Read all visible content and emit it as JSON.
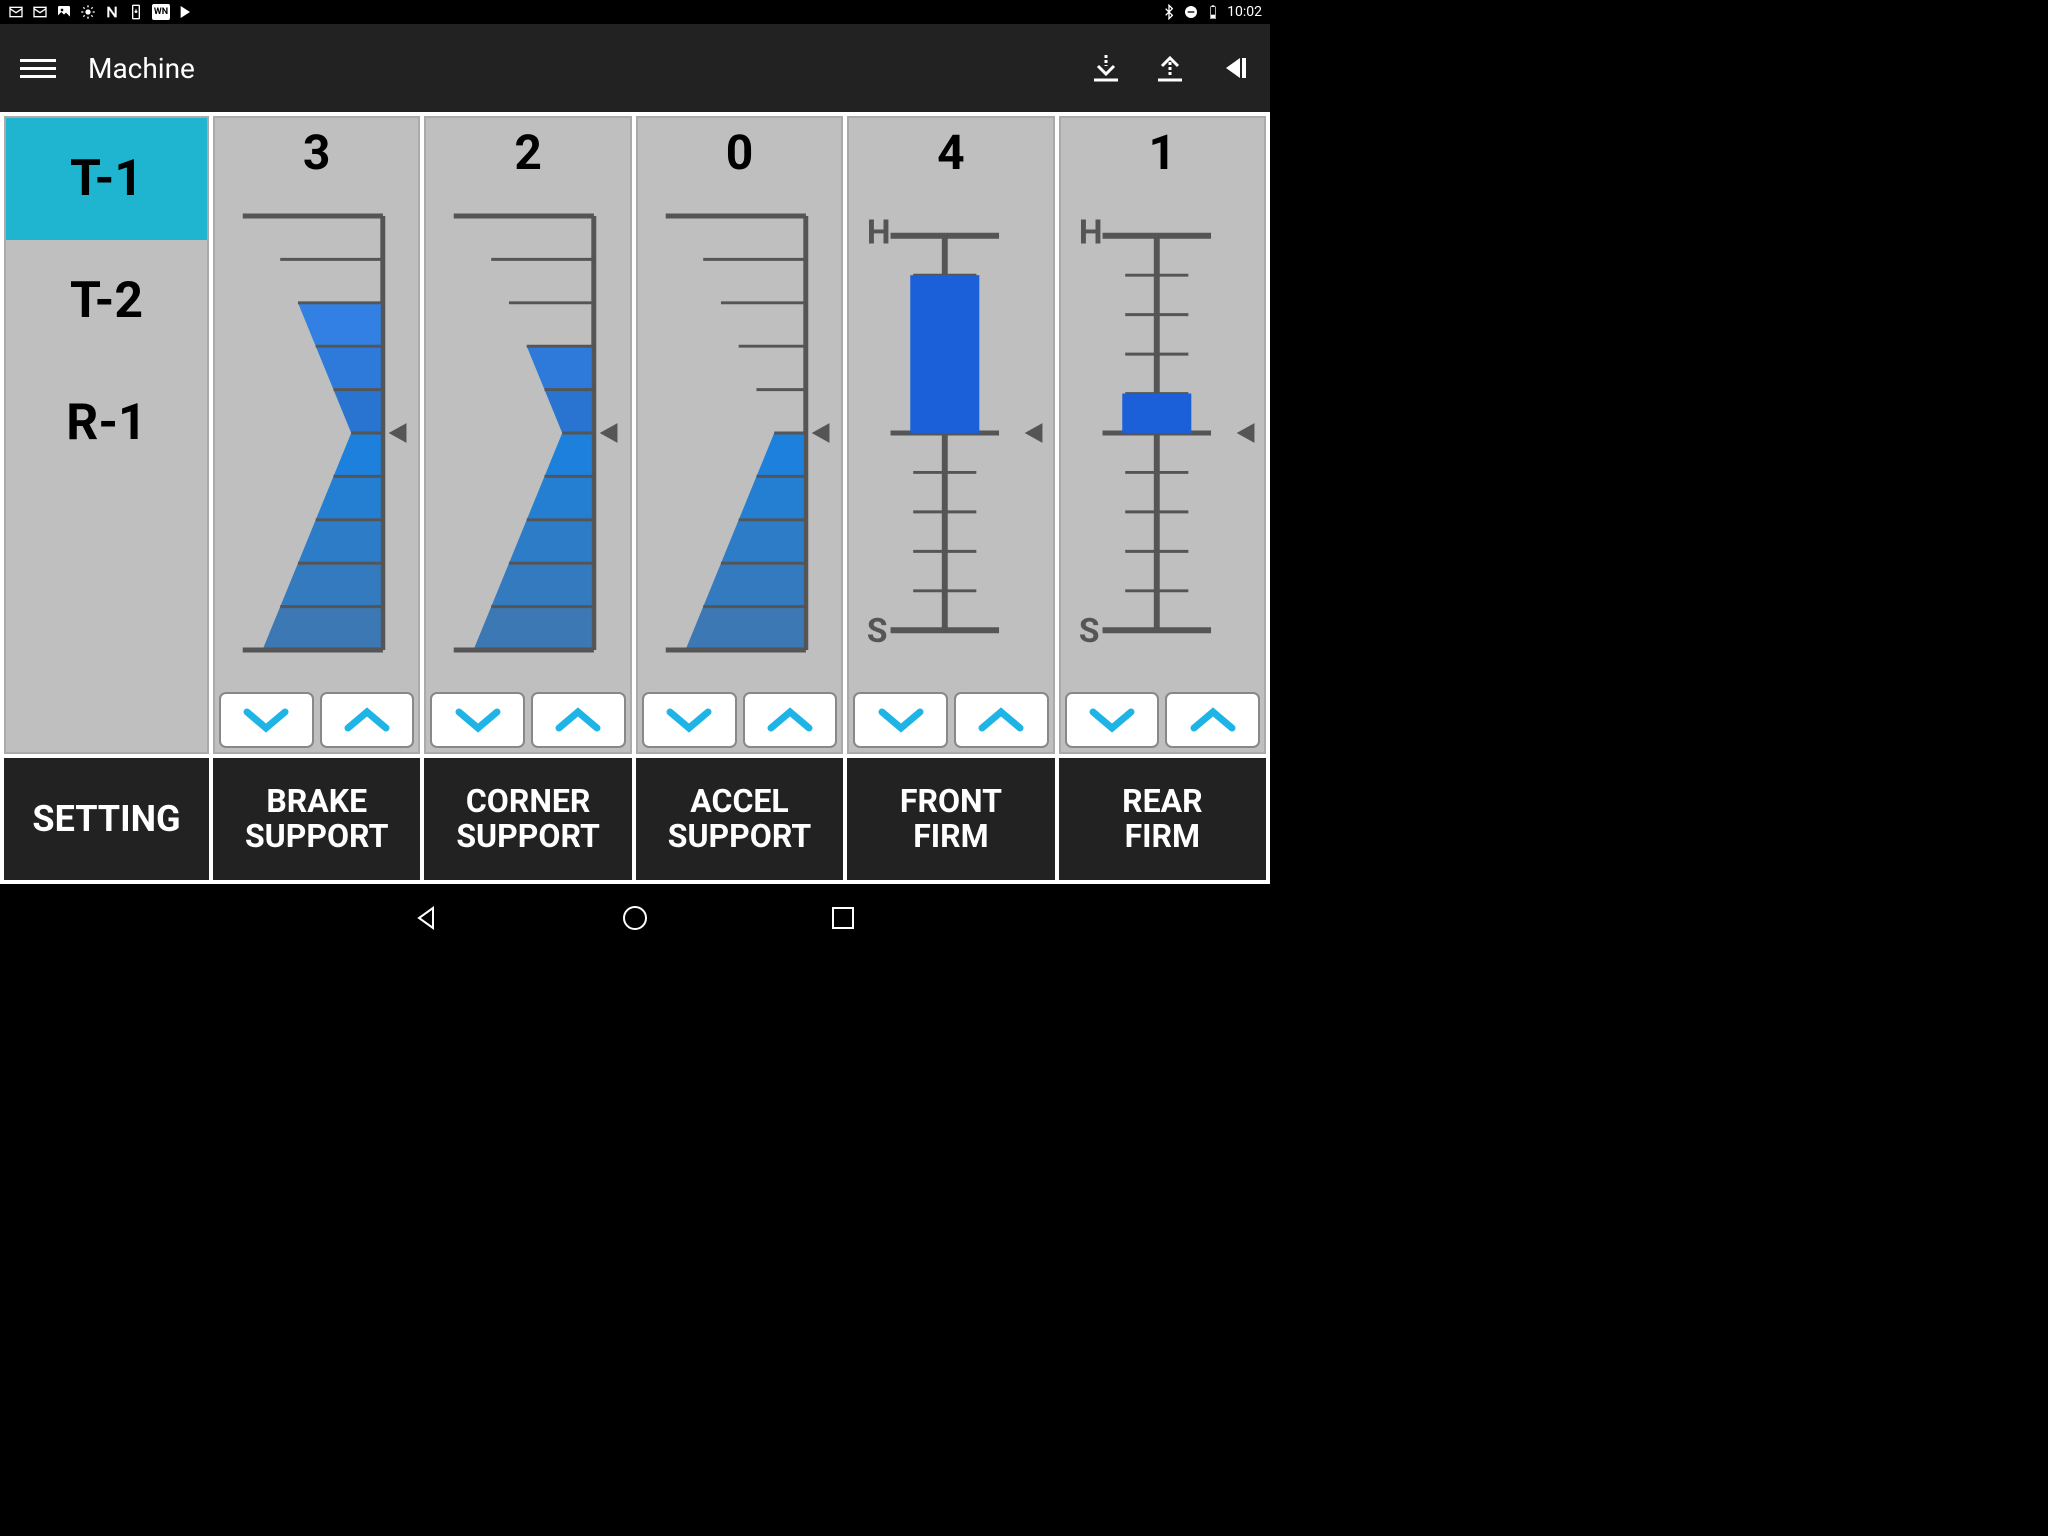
{
  "status_bar": {
    "time": "10:02"
  },
  "app_bar": {
    "title": "Machine"
  },
  "sidebar": {
    "presets": [
      {
        "label": "T-1",
        "active": true
      },
      {
        "label": "T-2",
        "active": false
      },
      {
        "label": "R-1",
        "active": false
      }
    ],
    "label": "SETTING"
  },
  "controls": [
    {
      "label": "BRAKE\nSUPPORT",
      "value": 3,
      "type": "fan",
      "max": 5,
      "min": -5
    },
    {
      "label": "CORNER\nSUPPORT",
      "value": 2,
      "type": "fan",
      "max": 5,
      "min": -5
    },
    {
      "label": "ACCEL\nSUPPORT",
      "value": 0,
      "type": "fan",
      "max": 5,
      "min": -5
    },
    {
      "label": "FRONT\nFIRM",
      "value": 4,
      "type": "slider",
      "max": 5,
      "min": -5,
      "top_label": "H",
      "bottom_label": "S"
    },
    {
      "label": "REAR\nFIRM",
      "value": 1,
      "type": "slider",
      "max": 5,
      "min": -5,
      "top_label": "H",
      "bottom_label": "S"
    }
  ]
}
